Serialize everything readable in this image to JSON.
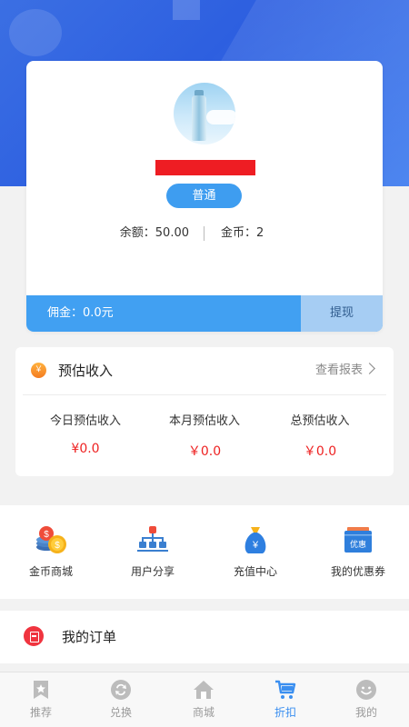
{
  "profile": {
    "level": "普通",
    "balance": "余额：50.00",
    "coins": "金币：2",
    "commission": "佣金：0.0元",
    "withdraw": "提现"
  },
  "income": {
    "title": "预估收入",
    "report_link": "查看报表",
    "icon_glyph": "￥",
    "columns": [
      {
        "label": "今日预估收入",
        "value": "¥0.0"
      },
      {
        "label": "本月预估收入",
        "value": "￥0.0"
      },
      {
        "label": "总预估收入",
        "value": "￥0.0"
      }
    ]
  },
  "quick_actions": [
    {
      "label": "金币商城",
      "icon": "coins-icon"
    },
    {
      "label": "用户分享",
      "icon": "org-share-icon"
    },
    {
      "label": "充值中心",
      "icon": "money-bag-icon"
    },
    {
      "label": "我的优惠券",
      "icon": "coupon-icon",
      "icon_text": "优惠"
    }
  ],
  "orders": {
    "label": "我的订单"
  },
  "tabbar": [
    {
      "label": "推荐",
      "icon": "star-bookmark-icon",
      "active": false
    },
    {
      "label": "兑换",
      "icon": "exchange-icon",
      "active": false
    },
    {
      "label": "商城",
      "icon": "home-icon",
      "active": false
    },
    {
      "label": "折扣",
      "icon": "cart-icon",
      "active": true
    },
    {
      "label": "我的",
      "icon": "smiley-icon",
      "active": false
    }
  ],
  "colors": {
    "accent": "#3e9df0",
    "value_red": "#ee2222",
    "active_tab": "#3b8ff0"
  }
}
